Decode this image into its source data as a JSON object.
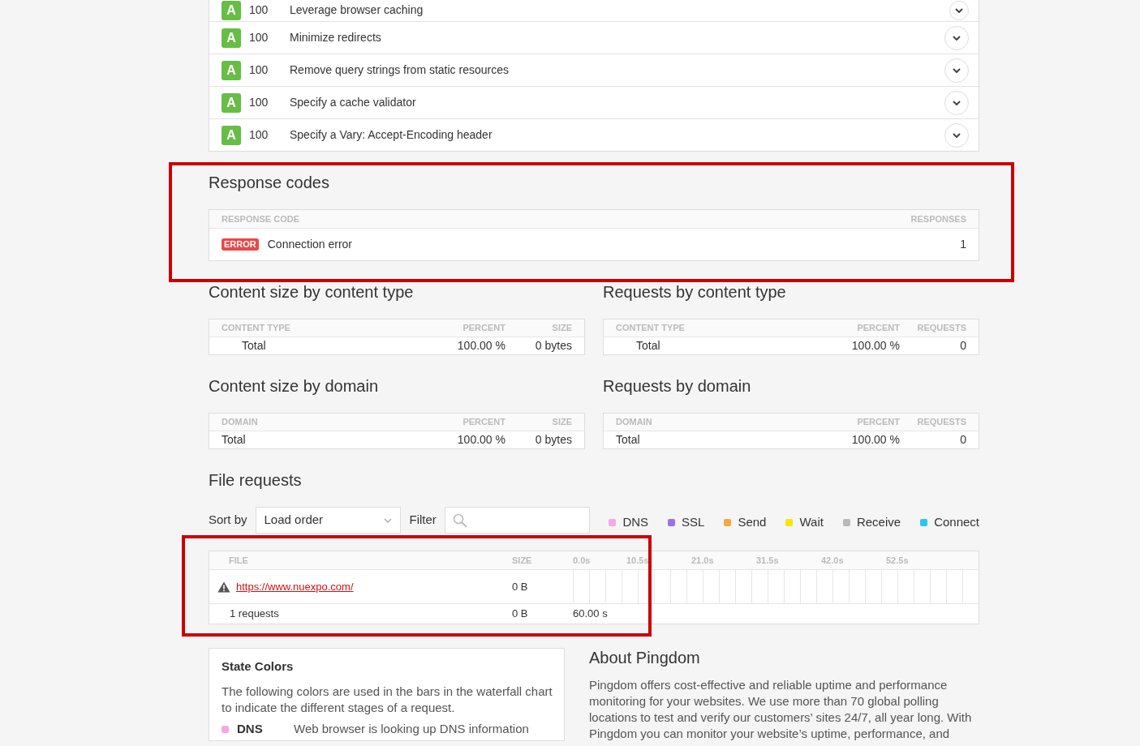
{
  "recommendations": [
    {
      "grade": "A",
      "score": "100",
      "title": "Leverage browser caching",
      "expanded": false
    },
    {
      "grade": "A",
      "score": "100",
      "title": "Minimize redirects",
      "expanded": false
    },
    {
      "grade": "A",
      "score": "100",
      "title": "Remove query strings from static resources",
      "expanded": false
    },
    {
      "grade": "A",
      "score": "100",
      "title": "Specify a cache validator",
      "expanded": false
    },
    {
      "grade": "A",
      "score": "100",
      "title": "Specify a Vary: Accept-Encoding header",
      "expanded": false
    }
  ],
  "response_codes": {
    "title": "Response codes",
    "highlighted": true,
    "columns": [
      "RESPONSE CODE",
      "RESPONSES"
    ],
    "rows": [
      {
        "status": "ERROR",
        "description": "Connection error",
        "count": "1"
      }
    ]
  },
  "breakdowns": [
    {
      "title": "Content size by content type",
      "kind": "content_type",
      "columns": [
        "CONTENT TYPE",
        "PERCENT",
        "SIZE"
      ],
      "rows": [
        {
          "cells": [
            "Total",
            "100.00 %",
            "0 bytes"
          ]
        }
      ]
    },
    {
      "title": "Requests by content type",
      "kind": "content_type",
      "columns": [
        "CONTENT TYPE",
        "PERCENT",
        "REQUESTS"
      ],
      "rows": [
        {
          "cells": [
            "Total",
            "100.00 %",
            "0"
          ]
        }
      ]
    },
    {
      "title": "Content size by domain",
      "kind": "domain",
      "columns": [
        "DOMAIN",
        "PERCENT",
        "SIZE"
      ],
      "rows": [
        {
          "cells": [
            "Total",
            "100.00 %",
            "0 bytes"
          ]
        }
      ]
    },
    {
      "title": "Requests by domain",
      "kind": "domain",
      "columns": [
        "DOMAIN",
        "PERCENT",
        "REQUESTS"
      ],
      "rows": [
        {
          "cells": [
            "Total",
            "100.00 %",
            "0"
          ]
        }
      ]
    }
  ],
  "file_requests": {
    "title": "File requests",
    "sort_label": "Sort by",
    "sort_value": "Load order",
    "filter_label": "Filter",
    "legend": [
      {
        "label": "DNS",
        "color": "#f7a8e4"
      },
      {
        "label": "SSL",
        "color": "#9b72ee"
      },
      {
        "label": "Send",
        "color": "#f6a842"
      },
      {
        "label": "Wait",
        "color": "#f7e700"
      },
      {
        "label": "Receive",
        "color": "#b9b9b9"
      },
      {
        "label": "Connect",
        "color": "#29c6f0"
      }
    ],
    "table": {
      "highlighted": true,
      "columns": [
        "FILE",
        "SIZE"
      ],
      "timeline_ticks": [
        "0.0s",
        "10.5s",
        "21.0s",
        "31.5s",
        "42.0s",
        "52.5s"
      ],
      "rows": [
        {
          "url": "https://www.nuexpo.com/",
          "size": "0 B",
          "warning": true
        }
      ],
      "summary": {
        "requests": "1 requests",
        "size": "0 B",
        "time": "60.00 s"
      }
    }
  },
  "state_colors": {
    "title": "State Colors",
    "text": "The following colors are used in the bars in the waterfall chart to indicate the different stages of a request.",
    "items": [
      {
        "label": "DNS",
        "description": "Web browser is looking up DNS information",
        "color": "#f7a8e4"
      }
    ]
  },
  "about": {
    "title": "About Pingdom",
    "text": "Pingdom offers cost-effective and reliable uptime and performance monitoring for your websites. We use more than 70 global polling locations to test and verify our customers’ sites 24/7, all year long. With Pingdom you can monitor your website’s uptime, performance, and"
  }
}
